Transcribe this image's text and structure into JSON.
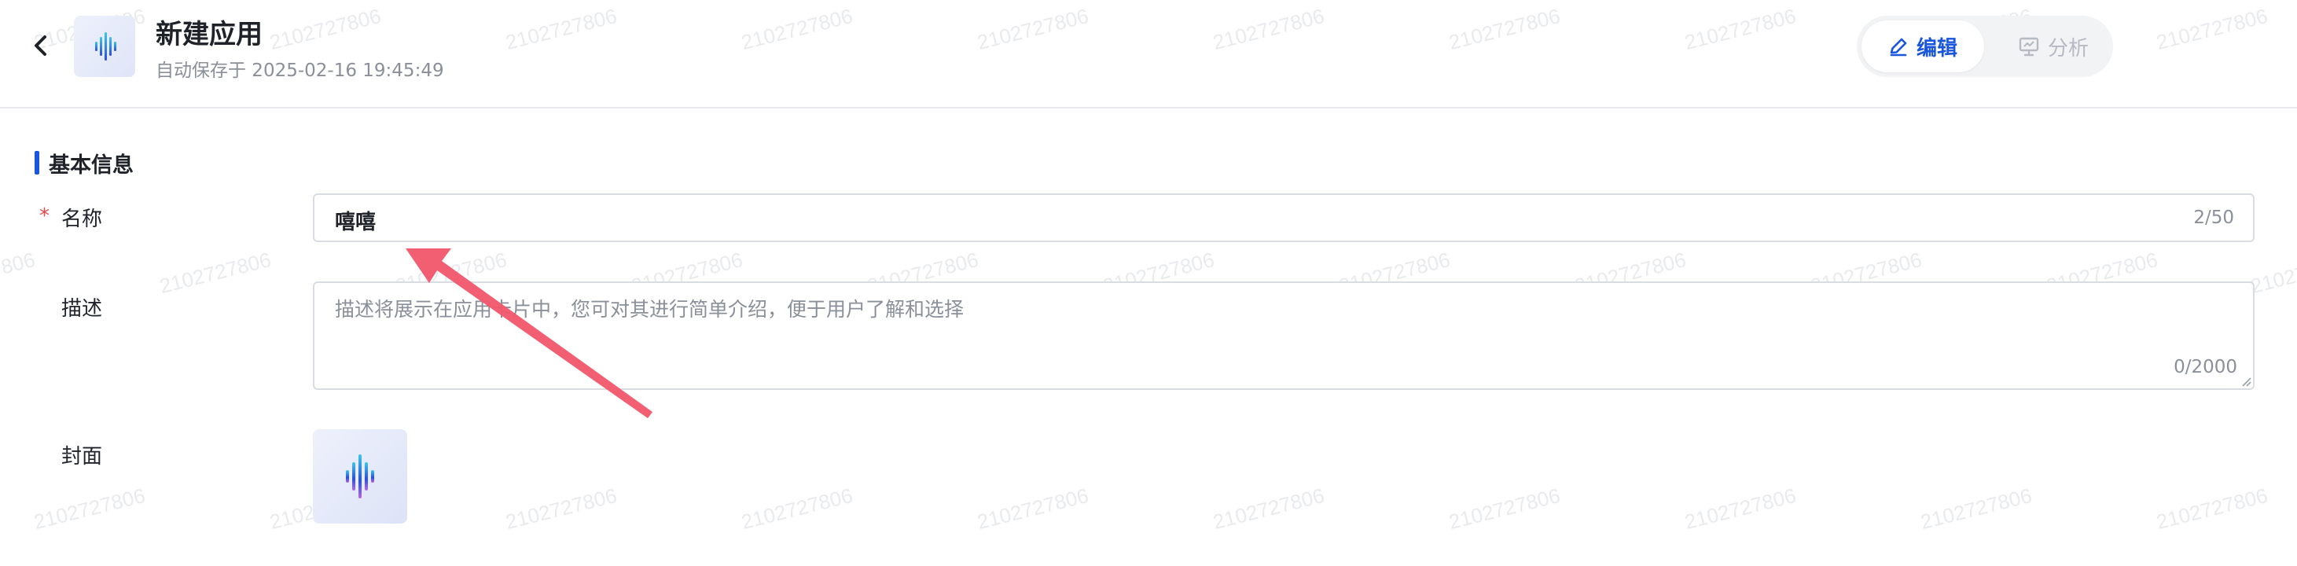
{
  "header": {
    "back_icon": "chevron-left-icon",
    "app_icon": "soundwave-logo-icon",
    "title": "新建应用",
    "autosave_text": "自动保存于 2025-02-16 19:45:49",
    "modes": [
      {
        "label": "编辑",
        "icon": "pencil-icon",
        "active": true
      },
      {
        "label": "分析",
        "icon": "monitor-chart-icon",
        "active": false
      }
    ]
  },
  "watermark_text": "2102727806",
  "section": {
    "title": "基本信息"
  },
  "form": {
    "name": {
      "required_mark": "*",
      "label": "名称",
      "value": "嘻嘻",
      "count": "2/50"
    },
    "description": {
      "label": "描述",
      "placeholder": "描述将展示在应用卡片中，您可对其进行简单介绍，便于用户了解和选择",
      "count": "0/2000"
    },
    "cover": {
      "label": "封面",
      "icon": "soundwave-logo-icon"
    }
  },
  "annotation": {
    "type": "arrow",
    "color": "#f2566a"
  },
  "colors": {
    "accent": "#1a56db",
    "required": "#e5484d",
    "border": "#d9dce1"
  }
}
